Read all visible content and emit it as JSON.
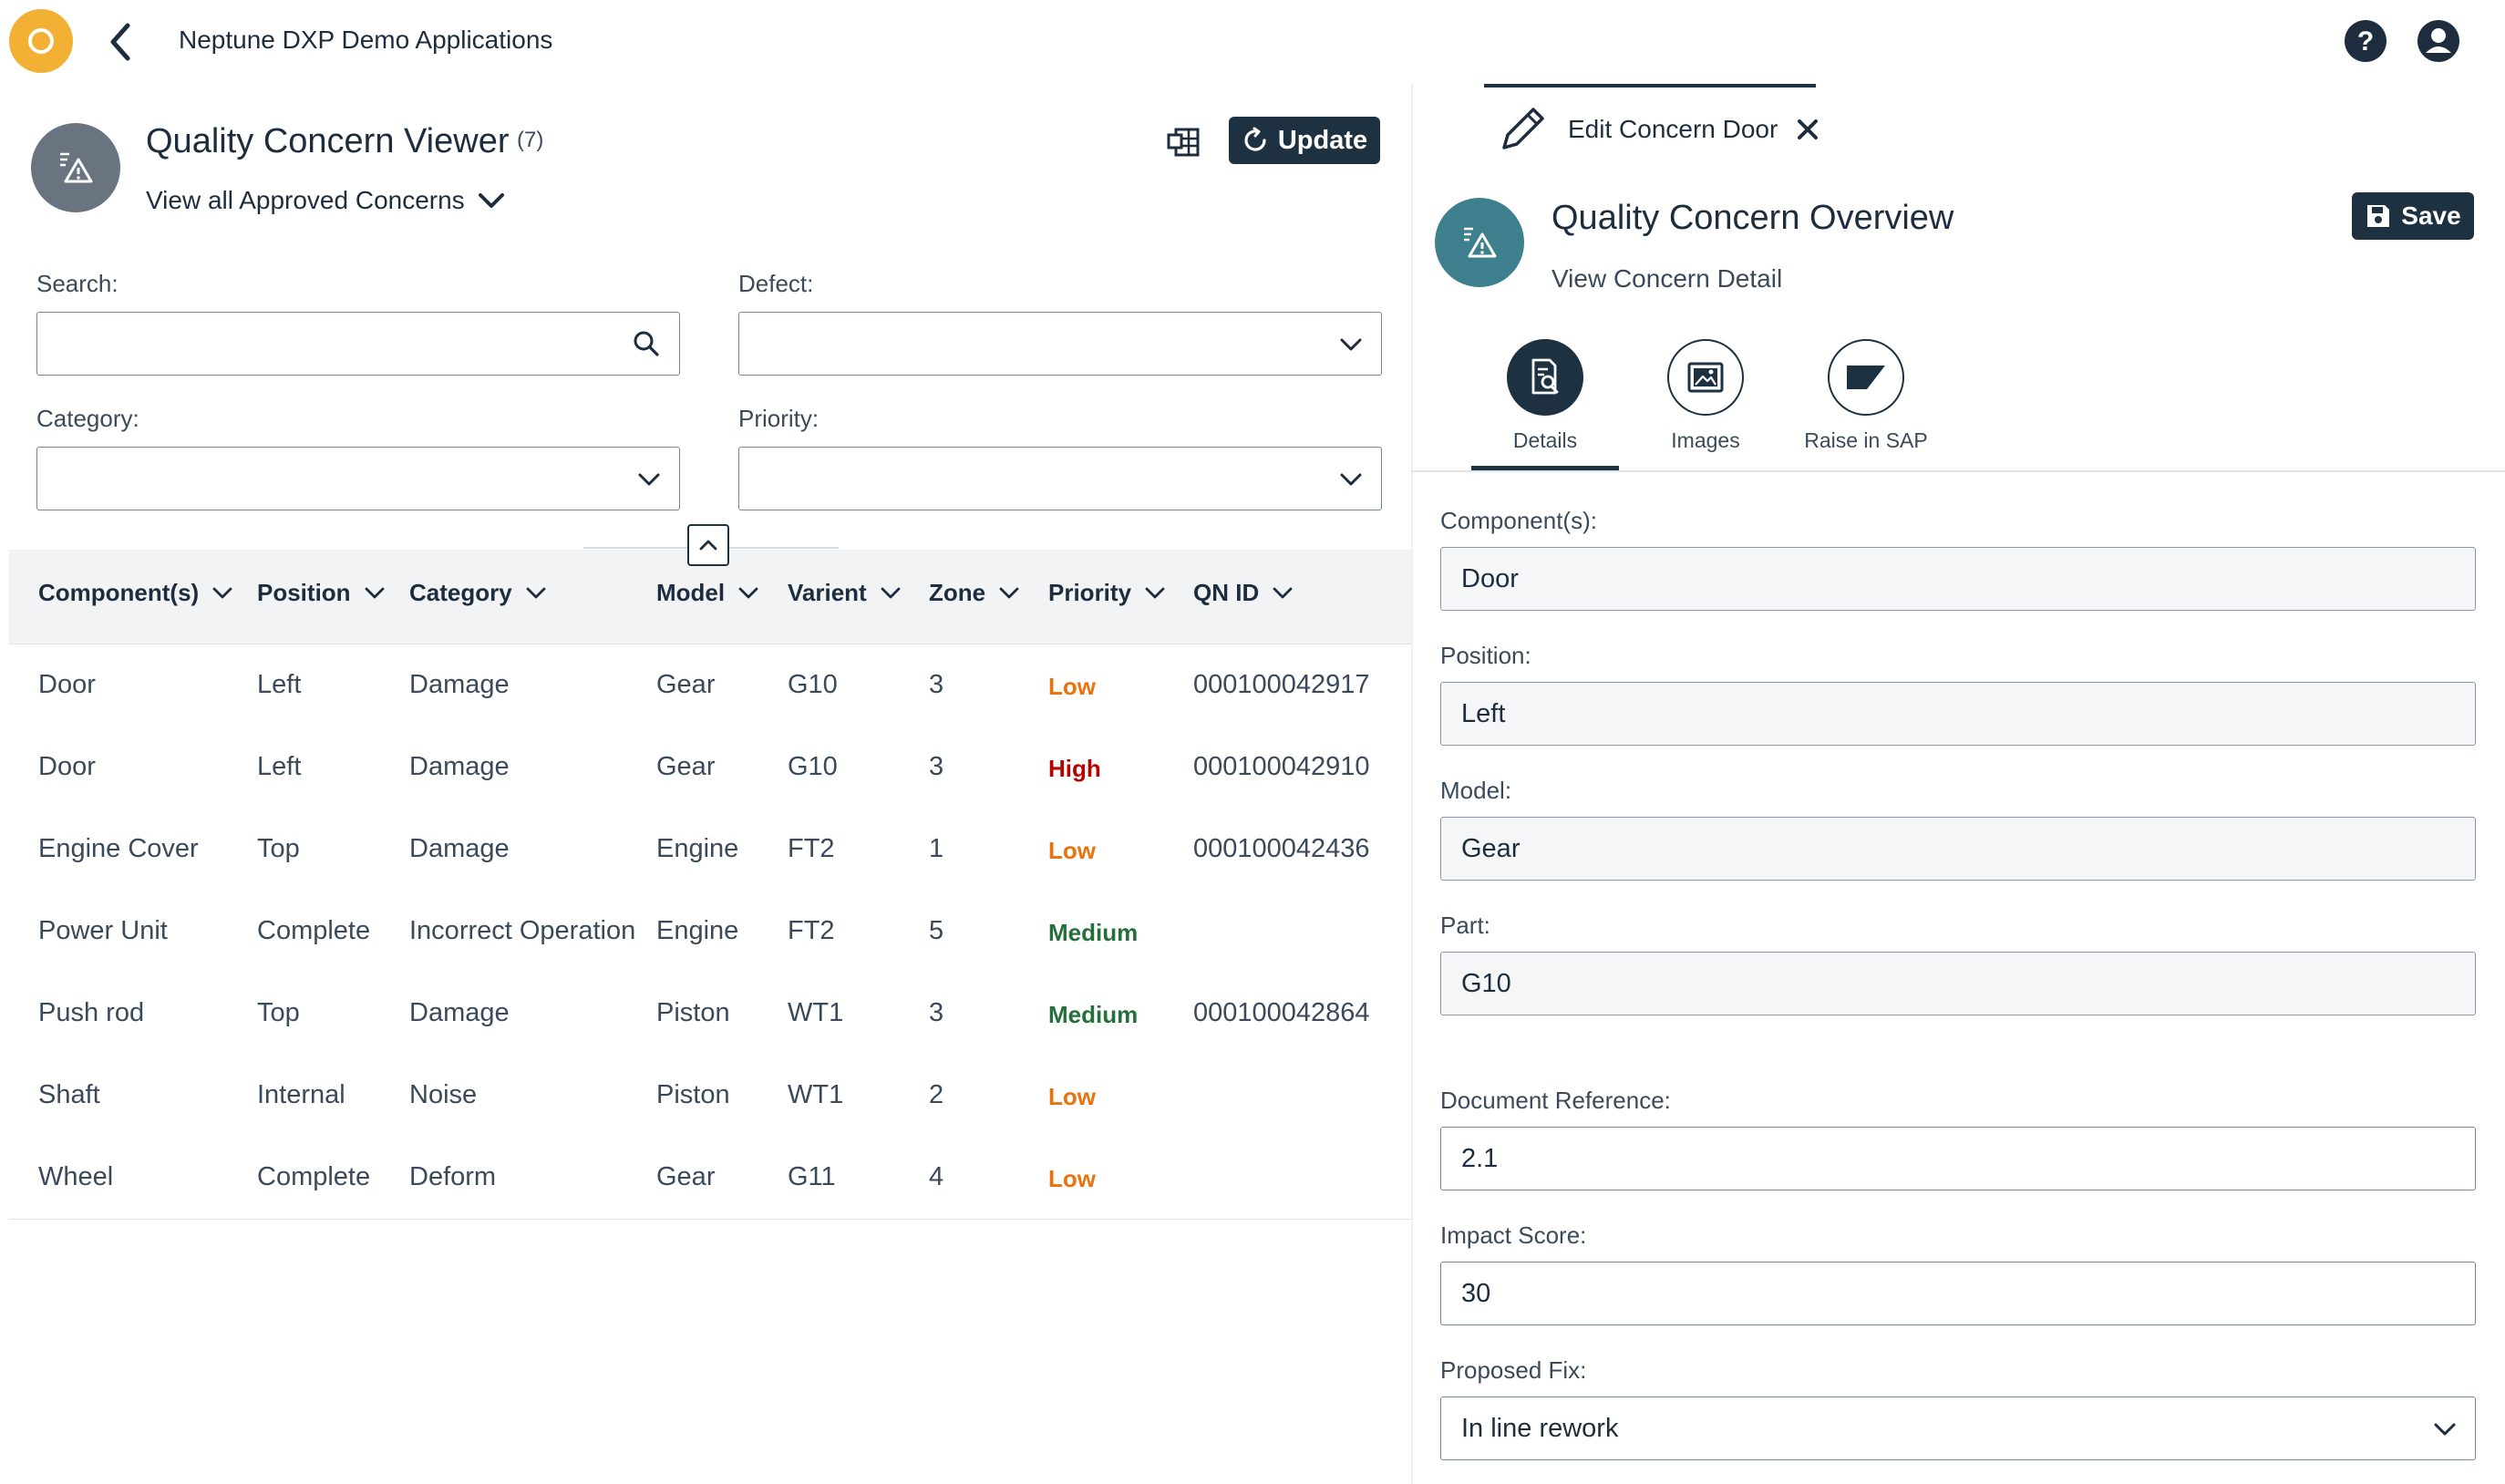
{
  "shell": {
    "title": "Neptune DXP Demo Applications",
    "help_icon": "question-circle-icon",
    "user_icon": "account-icon"
  },
  "viewer": {
    "title": "Quality Concern Viewer",
    "count": "(7)",
    "variant": "View all Approved Concerns",
    "update_label": "Update",
    "filters": {
      "search_label": "Search:",
      "search_value": "",
      "defect_label": "Defect:",
      "defect_value": "",
      "category_label": "Category:",
      "category_value": "",
      "priority_label": "Priority:",
      "priority_value": ""
    },
    "columns": [
      "Component(s)",
      "Position",
      "Category",
      "Model",
      "Varient",
      "Zone",
      "Priority",
      "QN ID"
    ],
    "rows": [
      {
        "component": "Door",
        "position": "Left",
        "category": "Damage",
        "model": "Gear",
        "varient": "G10",
        "zone": "3",
        "priority": "Low",
        "qnid": "000100042917"
      },
      {
        "component": "Door",
        "position": "Left",
        "category": "Damage",
        "model": "Gear",
        "varient": "G10",
        "zone": "3",
        "priority": "High",
        "qnid": "000100042910"
      },
      {
        "component": "Engine Cover",
        "position": "Top",
        "category": "Damage",
        "model": "Engine",
        "varient": "FT2",
        "zone": "1",
        "priority": "Low",
        "qnid": "000100042436"
      },
      {
        "component": "Power Unit",
        "position": "Complete",
        "category": "Incorrect Operation",
        "model": "Engine",
        "varient": "FT2",
        "zone": "5",
        "priority": "Medium",
        "qnid": ""
      },
      {
        "component": "Push rod",
        "position": "Top",
        "category": "Damage",
        "model": "Piston",
        "varient": "WT1",
        "zone": "3",
        "priority": "Medium",
        "qnid": "000100042864"
      },
      {
        "component": "Shaft",
        "position": "Internal",
        "category": "Noise",
        "model": "Piston",
        "varient": "WT1",
        "zone": "2",
        "priority": "Low",
        "qnid": ""
      },
      {
        "component": "Wheel",
        "position": "Complete",
        "category": "Deform",
        "model": "Gear",
        "varient": "G11",
        "zone": "4",
        "priority": "Low",
        "qnid": ""
      }
    ],
    "priority_colors": {
      "Low": "#e9730c",
      "High": "#bb0000",
      "Medium": "#256f3a"
    }
  },
  "editor": {
    "tab_label": "Edit Concern Door",
    "title": "Quality Concern Overview",
    "subtitle": "View Concern Detail",
    "save_label": "Save",
    "icon_tabs": [
      "Details",
      "Images",
      "Raise in SAP"
    ],
    "fields": {
      "component_label": "Component(s):",
      "component_value": "Door",
      "position_label": "Position:",
      "position_value": "Left",
      "model_label": "Model:",
      "model_value": "Gear",
      "part_label": "Part:",
      "part_value": "G10",
      "docref_label": "Document Reference:",
      "docref_value": "2.1",
      "impact_label": "Impact Score:",
      "impact_value": "30",
      "fix_label": "Proposed Fix:",
      "fix_value": "In line rework"
    }
  },
  "colors": {
    "accent": "#1d3140",
    "avatar_gray": "#6a7480",
    "avatar_teal": "#3d7f8d",
    "logo": "#f2b134"
  }
}
